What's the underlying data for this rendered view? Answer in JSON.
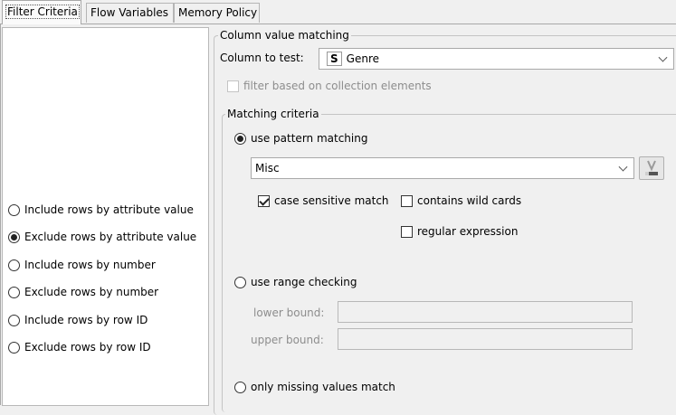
{
  "tabs": [
    {
      "label": "Filter Criteria",
      "active": true
    },
    {
      "label": "Flow Variables",
      "active": false
    },
    {
      "label": "Memory Policy",
      "active": false
    }
  ],
  "left_options": [
    {
      "label": "Include rows by attribute value",
      "checked": false
    },
    {
      "label": "Exclude rows by attribute value",
      "checked": true
    },
    {
      "label": "Include rows by number",
      "checked": false
    },
    {
      "label": "Exclude rows by number",
      "checked": false
    },
    {
      "label": "Include rows by row ID",
      "checked": false
    },
    {
      "label": "Exclude rows by row ID",
      "checked": false
    }
  ],
  "column_matching": {
    "legend": "Column value matching",
    "column_label": "Column to test:",
    "column_type_badge": "S",
    "column_value": "Genre",
    "collection_label": "filter based on collection elements"
  },
  "matching_criteria": {
    "legend": "Matching criteria",
    "pattern_label": "use pattern matching",
    "pattern_value": "Misc",
    "variable_button_icon": "flow-variable-icon",
    "case_sensitive_label": "case sensitive match",
    "wild_cards_label": "contains wild cards",
    "regex_label": "regular expression",
    "range_label": "use range checking",
    "lower_bound_label": "lower bound:",
    "upper_bound_label": "upper bound:",
    "missing_label": "only missing values match"
  }
}
